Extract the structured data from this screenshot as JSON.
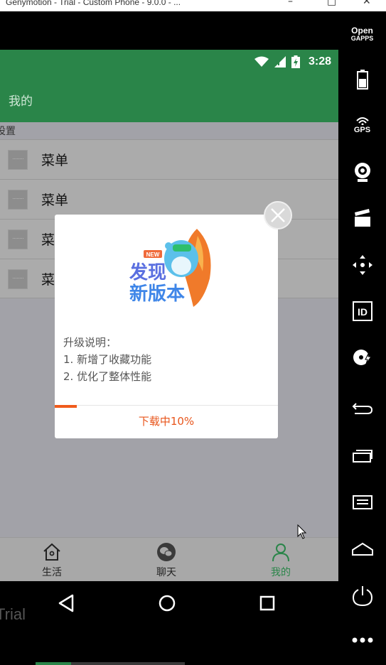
{
  "window": {
    "title": "Genymotion - Trial - Custom Phone - 9.0.0 - ...",
    "minimize": "–",
    "maximize": "□",
    "close": "✕"
  },
  "status_bar": {
    "time": "3:28",
    "icons": [
      "wifi-icon",
      "signal-icon",
      "battery-charging-icon"
    ]
  },
  "app_bar": {
    "title": "我的"
  },
  "section": {
    "header": "设置"
  },
  "menu": {
    "items": [
      {
        "label": "菜单"
      },
      {
        "label": "菜单"
      },
      {
        "label": "菜单"
      },
      {
        "label": "菜单"
      }
    ]
  },
  "dialog": {
    "badge": "NEW",
    "hero_line1": "发现",
    "hero_line2": "新版本",
    "notes_title": "升级说明：",
    "notes": [
      "1. 新增了收藏功能",
      "2. 优化了整体性能"
    ],
    "progress_percent": 10,
    "download_label": "下载中10%",
    "accent_color": "#f05b1c"
  },
  "bottom_nav": {
    "items": [
      {
        "label": "生活",
        "icon": "home-icon",
        "active": false
      },
      {
        "label": "聊天",
        "icon": "chat-icon",
        "active": false
      },
      {
        "label": "我的",
        "icon": "profile-icon",
        "active": true
      }
    ],
    "active_color": "#2a8549"
  },
  "watermark": {
    "text": "Trial"
  },
  "toolbar": {
    "opengapps_line1": "Open",
    "opengapps_line2": "GAPPS",
    "gps_label": "GPS",
    "id_label": "ID",
    "items": [
      "opengapps-icon",
      "battery-icon",
      "gps-icon",
      "webcam-icon",
      "clapperboard-icon",
      "dpad-icon",
      "id-icon",
      "media-icon",
      "back-icon",
      "recent-apps-icon",
      "menu-icon",
      "home-icon",
      "power-icon",
      "more-icon"
    ]
  },
  "colors": {
    "primary": "#2a8549",
    "overlay": "#a2a2a8"
  }
}
